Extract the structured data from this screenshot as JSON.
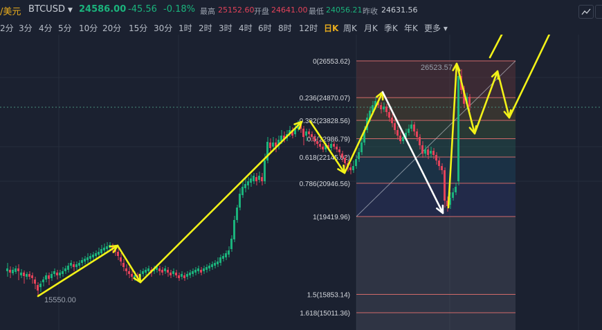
{
  "header": {
    "pair": "/美元",
    "symbol": "BTCUSD",
    "last": "24586.00",
    "change": "-45.56",
    "change_pct": "-0.18%",
    "high_label": "最高",
    "high": "25152.60",
    "open_label": "开盘",
    "open": "24641.00",
    "low_label": "最低",
    "low": "24056.21",
    "prev_close_label": "昨收",
    "prev_close": "24631.56"
  },
  "intervals": [
    "2分",
    "3分",
    "4分",
    "5分",
    "10分",
    "20分",
    "15分",
    "30分",
    "1时",
    "2时",
    "3时",
    "4时",
    "6时",
    "8时",
    "12时",
    "日K",
    "周K",
    "月K",
    "季K",
    "年K",
    "更多"
  ],
  "active_interval": "日K",
  "colors": {
    "up": "#1bb37c",
    "down": "#e3435a",
    "arrow": "#f2f218",
    "accent": "#e8ac1d"
  },
  "fib": {
    "levels": [
      {
        "label": "0(26553.62)",
        "value": 26553.62
      },
      {
        "label": "0.236(24870.07)",
        "value": 24870.07
      },
      {
        "label": "0.382(23828.56)",
        "value": 23828.56
      },
      {
        "label": "0.5(22986.79)",
        "value": 22986.79
      },
      {
        "label": "0.618(22145.02)",
        "value": 22145.02
      },
      {
        "label": "0.786(20946.56)",
        "value": 20946.56
      },
      {
        "label": "1(19419.96)",
        "value": 19419.96
      },
      {
        "label": "1.5(15853.14)",
        "value": 15853.14
      },
      {
        "label": "1.618(15011.36)",
        "value": 15011.36
      }
    ]
  },
  "chart_labels": {
    "high_marker": "26523.57",
    "low_marker": "15550.00"
  }
}
